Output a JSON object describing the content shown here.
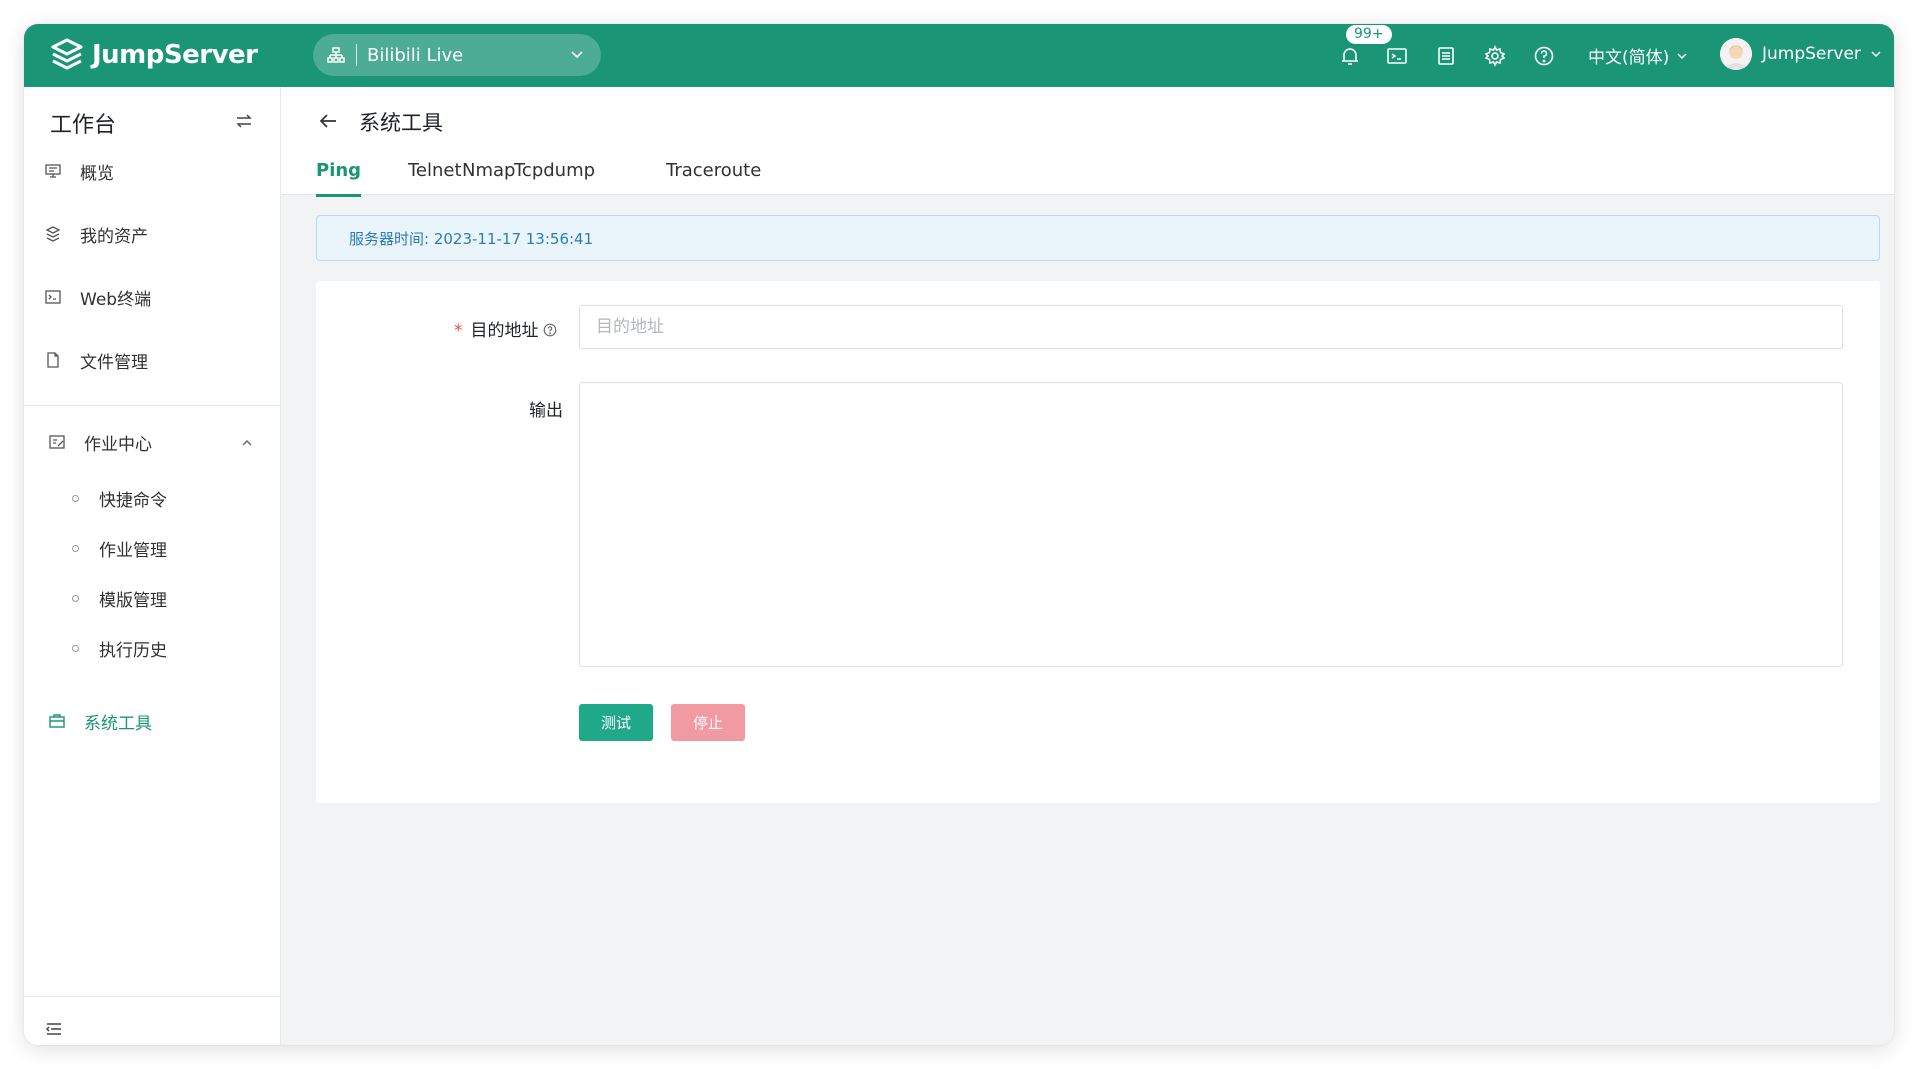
{
  "header": {
    "brand": "JumpServer",
    "org": "Bilibili Live",
    "notification_badge": "99+",
    "icons": [
      "bell-icon",
      "terminal-icon",
      "list-icon",
      "gear-icon",
      "help-icon"
    ],
    "language": "中文(简体)",
    "username": "JumpServer"
  },
  "sidebar": {
    "title": "工作台",
    "items": [
      {
        "label": "概览",
        "icon": "monitor-icon"
      },
      {
        "label": "我的资产",
        "icon": "stack-icon"
      },
      {
        "label": "Web终端",
        "icon": "terminal-icon"
      },
      {
        "label": "文件管理",
        "icon": "file-icon"
      },
      {
        "label": "作业中心",
        "icon": "job-icon",
        "expanded": true
      }
    ],
    "sub_items": [
      "快捷命令",
      "作业管理",
      "模版管理",
      "执行历史"
    ],
    "active_item": "系统工具"
  },
  "page": {
    "title": "系统工具",
    "tabs": [
      "Ping",
      "Telnet",
      "Nmap",
      "Tcpdump",
      "Traceroute"
    ],
    "active_tab": "Ping",
    "server_time": "服务器时间: 2023-11-17 13:56:41",
    "form": {
      "target_label": "目的地址",
      "target_placeholder": "目的地址",
      "target_value": "",
      "output_label": "输出",
      "test_button": "测试",
      "stop_button": "停止"
    }
  },
  "colors": {
    "brand": "#1a9576",
    "primary_button": "#1fa88a",
    "danger_button_disabled": "#f29aa2",
    "info_text": "#2a7db8"
  }
}
